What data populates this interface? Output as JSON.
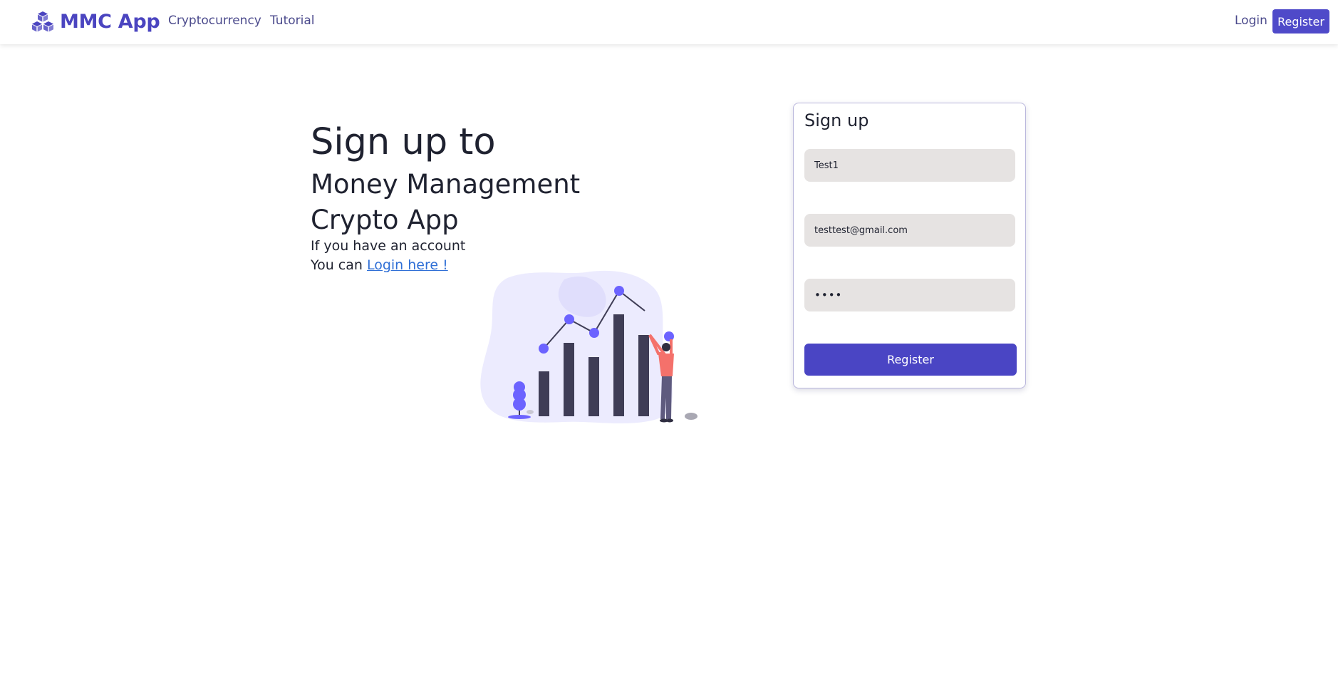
{
  "navbar": {
    "brand": "MMC App",
    "links": [
      "Cryptocurrency",
      "Tutorial"
    ],
    "login": "Login",
    "register": "Register"
  },
  "hero": {
    "title": "Sign up to",
    "subtitle_line1": "Money Management",
    "subtitle_line2": "Crypto App",
    "note_line1": "If you have an account",
    "note_line2_prefix": "You can ",
    "login_link": "Login here !"
  },
  "form": {
    "title": "Sign up",
    "name_value": "Test1",
    "email_value": "testtest@gmail.com",
    "password_value": "••••",
    "submit": "Register"
  },
  "colors": {
    "brand": "#4b45c0",
    "primary_button": "#4a45c4",
    "link": "#2f6fd6",
    "field_bg": "#e6e3e2",
    "illustration_accent": "#6c63ff",
    "figure_shirt": "#f4716b"
  },
  "icons": {
    "brand": "cubes-icon"
  }
}
